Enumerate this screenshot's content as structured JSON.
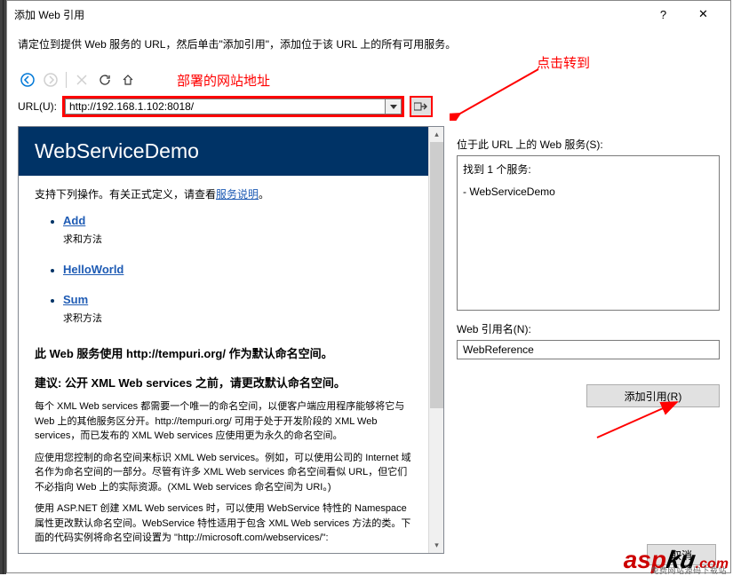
{
  "titlebar": {
    "title": "添加 Web 引用"
  },
  "instruction": "请定位到提供 Web 服务的 URL，然后单击\"添加引用\"，添加位于该 URL 上的所有可用服务。",
  "annotations": {
    "deploy_label": "部署的网站地址",
    "click_go": "点击转到"
  },
  "url": {
    "label": "URL(U):",
    "value": "http://192.168.1.102:8018/"
  },
  "webservice": {
    "title": "WebServiceDemo",
    "support_text_pre": "支持下列操作。有关正式定义，请查看",
    "service_desc_link": "服务说明",
    "support_text_post": "。",
    "operations": [
      {
        "name": "Add",
        "desc": "求和方法"
      },
      {
        "name": "HelloWorld",
        "desc": ""
      },
      {
        "name": "Sum",
        "desc": "求积方法"
      }
    ],
    "namespace_heading": "此 Web 服务使用 http://tempuri.org/ 作为默认命名空间。",
    "recommendation": "建议: 公开 XML Web services 之前，请更改默认命名空间。",
    "para1": "每个 XML Web services 都需要一个唯一的命名空间，以便客户端应用程序能够将它与 Web 上的其他服务区分开。http://tempuri.org/ 可用于处于开发阶段的 XML Web services，而已发布的 XML Web services 应使用更为永久的命名空间。",
    "para2": "应使用您控制的命名空间来标识 XML Web services。例如，可以使用公司的 Internet 域名作为命名空间的一部分。尽管有许多 XML Web services 命名空间看似 URL，但它们不必指向 Web 上的实际资源。(XML Web services 命名空间为 URI。)",
    "para3": "使用 ASP.NET 创建 XML Web services 时，可以使用 WebService 特性的 Namespace 属性更改默认命名空间。WebService 特性适用于包含 XML Web services 方法的类。下面的代码实例将命名空间设置为 \"http://microsoft.com/webservices/\":"
  },
  "right": {
    "services_label": "位于此 URL 上的 Web 服务(S):",
    "found_text": "找到 1 个服务:",
    "service_item": "- WebServiceDemo",
    "refname_label": "Web 引用名(N):",
    "refname_value": "WebReference",
    "add_button": "添加引用(R)"
  },
  "bottom": {
    "cancel": "取消"
  }
}
